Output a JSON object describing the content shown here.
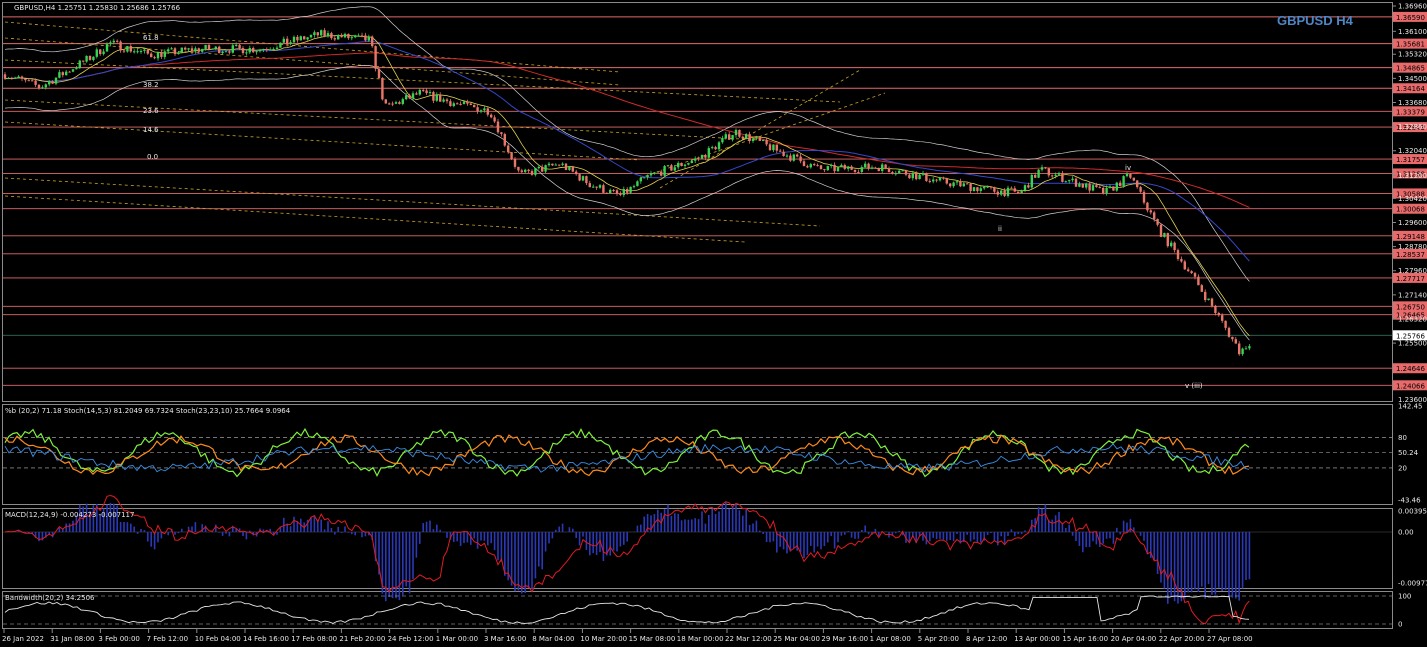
{
  "window": {
    "symbol_header": "GBPUSD,H4  1.25751 1.25830 1.25686 1.25766",
    "watermark": "GBPUSD H4"
  },
  "main_chart": {
    "price_axis_ticks": [
      "1.36960",
      "1.36100",
      "1.35320",
      "1.34500",
      "1.33680",
      "1.32860",
      "1.32040",
      "1.31200",
      "1.30420",
      "1.29600",
      "1.28780",
      "1.27960",
      "1.27140",
      "1.26320",
      "1.25500"
    ],
    "level_tags": [
      {
        "label": "1.36590",
        "color": "#e86a6a"
      },
      {
        "label": "1.35681",
        "color": "#e86a6a"
      },
      {
        "label": "1.34865",
        "color": "#e86a6a"
      },
      {
        "label": "1.34164",
        "color": "#e86a6a"
      },
      {
        "label": "1.33379",
        "color": "#e86a6a"
      },
      {
        "label": "1.32843",
        "color": "#e86a6a"
      },
      {
        "label": "1.31757",
        "color": "#e86a6a"
      },
      {
        "label": "1.31268",
        "color": "#e86a6a"
      },
      {
        "label": "1.30588",
        "color": "#e86a6a"
      },
      {
        "label": "1.30068",
        "color": "#e86a6a"
      },
      {
        "label": "1.29148",
        "color": "#e86a6a"
      },
      {
        "label": "1.28537",
        "color": "#e86a6a"
      },
      {
        "label": "1.27717",
        "color": "#e86a6a"
      },
      {
        "label": "1.26750",
        "color": "#e86a6a"
      },
      {
        "label": "1.26465",
        "color": "#e86a6a"
      },
      {
        "label": "1.24646",
        "color": "#e86a6a"
      },
      {
        "label": "1.24066",
        "color": "#e86a6a"
      }
    ],
    "current_price": "1.25766",
    "bottom_tick": "1.23600",
    "fib_labels": [
      "61.8",
      "38.2",
      "23.6",
      "14.6",
      "0.0"
    ],
    "wave_labels": [
      "iv",
      "ii",
      "v (iii)"
    ]
  },
  "stoch_panel": {
    "header": "%b (20,2) 71.18  Stoch(14,5,3) 81.2049 69.7324  Stoch(23,23,10) 25.7664 9.0964",
    "ticks": [
      "142.45",
      "80",
      "50.24",
      "20",
      "-43.46"
    ]
  },
  "macd_panel": {
    "header": "MACD(12,24,9) -0.004273 -0.007117",
    "ticks": [
      "0.003959",
      "0.00",
      "-0.009778"
    ]
  },
  "bandwidth_panel": {
    "header": "Bandwidth(20,2) 34.2506",
    "ticks": [
      "100",
      "0"
    ]
  },
  "time_axis": [
    "26 Jan 2022",
    "31 Jan 08:00",
    "3 Feb 00:00",
    "7 Feb 12:00",
    "10 Feb 04:00",
    "14 Feb 16:00",
    "17 Feb 08:00",
    "21 Feb 20:00",
    "24 Feb 12:00",
    "1 Mar 00:00",
    "3 Mar 16:00",
    "8 Mar 04:00",
    "10 Mar 20:00",
    "15 Mar 08:00",
    "18 Mar 00:00",
    "22 Mar 12:00",
    "25 Mar 04:00",
    "29 Mar 16:00",
    "1 Apr 08:00",
    "5 Apr 20:00",
    "8 Apr 12:00",
    "13 Apr 00:00",
    "15 Apr 16:00",
    "20 Apr 04:00",
    "22 Apr 20:00",
    "27 Apr 08:00"
  ],
  "colors": {
    "up_candle": "#39d353",
    "down_candle": "#e8776a",
    "level_line": "#e36b6b",
    "ma_long": "#d12a2a",
    "ma_mid": "#3448c9",
    "bands": "#cfcfcf",
    "fib": "#c9a227",
    "stoch_fast": "#7ef23a",
    "stoch_slow": "#ff8a1c",
    "stoch_base": "#3a8ee8",
    "macd_hist": "#2b39b8",
    "macd_signal": "#e01b24"
  }
}
